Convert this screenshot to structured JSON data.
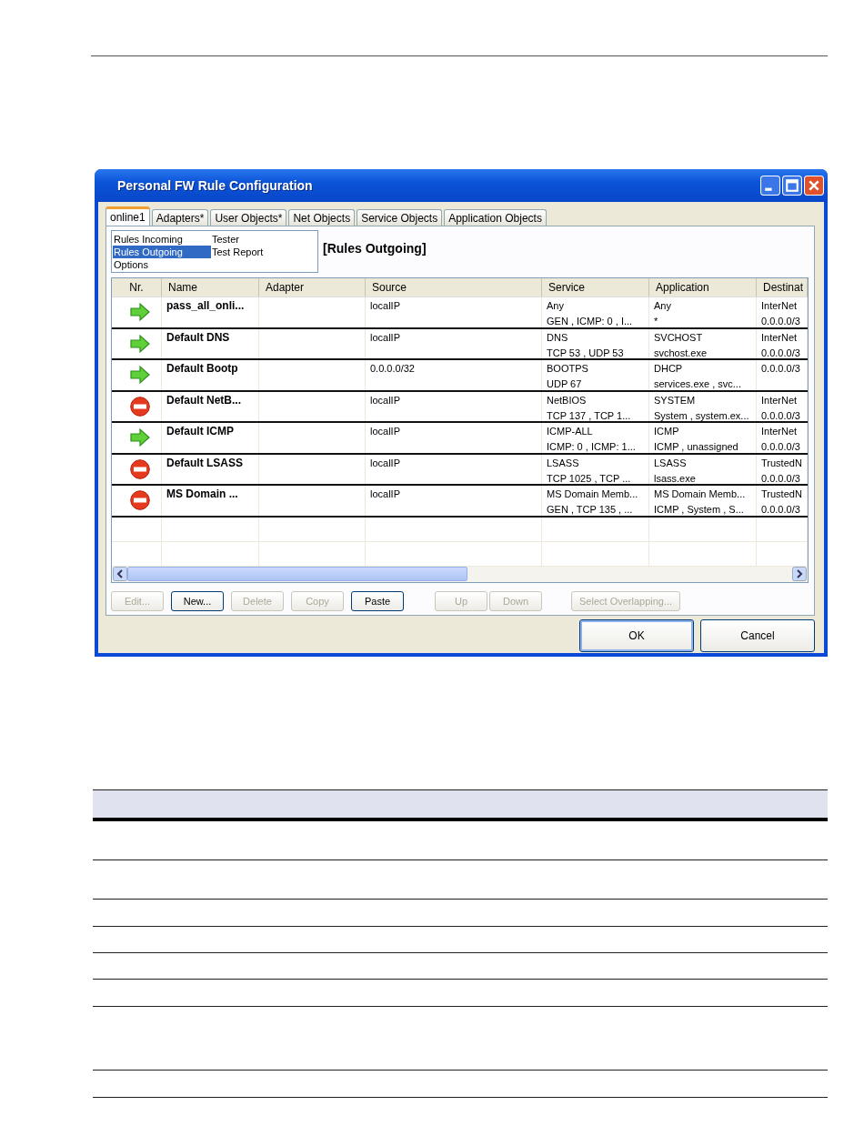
{
  "window": {
    "title": "Personal FW Rule Configuration"
  },
  "tabs": [
    {
      "label": "online1",
      "selected": true
    },
    {
      "label": "Adapters*",
      "selected": false
    },
    {
      "label": "User Objects*",
      "selected": false
    },
    {
      "label": "Net Objects",
      "selected": false
    },
    {
      "label": "Service Objects",
      "selected": false
    },
    {
      "label": "Application Objects",
      "selected": false
    }
  ],
  "nav_list": [
    {
      "label": "Rules Incoming",
      "selected": false
    },
    {
      "label": "Rules Outgoing",
      "selected": true
    },
    {
      "label": "Options",
      "selected": false
    },
    {
      "label": "Tester",
      "selected": false
    },
    {
      "label": "Test Report",
      "selected": false
    }
  ],
  "section_title": "[Rules Outgoing]",
  "table": {
    "columns": [
      "Nr.",
      "Name",
      "Adapter",
      "Source",
      "Service",
      "Application",
      "Destinat"
    ],
    "rows": [
      {
        "kind": "allow",
        "name": "pass_all_onli...",
        "source": "localIP",
        "service": [
          "Any",
          "GEN  , ICMP: 0 , I..."
        ],
        "application": [
          "Any",
          "*"
        ],
        "destination": [
          "InterNet",
          "0.0.0.0/3"
        ]
      },
      {
        "kind": "allow",
        "name": "Default DNS",
        "source": "localIP",
        "service": [
          "DNS",
          "TCP  53 , UDP  53"
        ],
        "application": [
          "SVCHOST",
          "svchost.exe"
        ],
        "destination": [
          "InterNet",
          "0.0.0.0/3"
        ]
      },
      {
        "kind": "allow",
        "name": "Default Bootp",
        "source": "0.0.0.0/32",
        "service": [
          "BOOTPS",
          "UDP  67"
        ],
        "application": [
          "DHCP",
          "services.exe , svc..."
        ],
        "destination": [
          "0.0.0.0/3"
        ]
      },
      {
        "kind": "deny",
        "name": "Default NetB...",
        "source": "localIP",
        "service": [
          "NetBIOS",
          "TCP  137 , TCP  1..."
        ],
        "application": [
          "SYSTEM",
          "System , system.ex..."
        ],
        "destination": [
          "InterNet",
          "0.0.0.0/3"
        ]
      },
      {
        "kind": "allow",
        "name": "Default ICMP",
        "source": "localIP",
        "service": [
          "ICMP-ALL",
          "ICMP: 0 , ICMP: 1..."
        ],
        "application": [
          "ICMP",
          "ICMP , unassigned"
        ],
        "destination": [
          "InterNet",
          "0.0.0.0/3"
        ]
      },
      {
        "kind": "deny",
        "name": "Default LSASS",
        "source": "localIP",
        "service": [
          "LSASS",
          "TCP  1025 , TCP  ..."
        ],
        "application": [
          "LSASS",
          "lsass.exe"
        ],
        "destination": [
          "TrustedN",
          "0.0.0.0/3"
        ]
      },
      {
        "kind": "deny",
        "name": "MS Domain ...",
        "source": "localIP",
        "service": [
          "MS Domain Memb...",
          "GEN  , TCP  135 , ..."
        ],
        "application": [
          "MS Domain Memb...",
          "ICMP , System , S..."
        ],
        "destination": [
          "TrustedN",
          "0.0.0.0/3"
        ]
      }
    ]
  },
  "actions": [
    {
      "label": "Edit...",
      "disabled": true
    },
    {
      "label": "New...",
      "disabled": false
    },
    {
      "label": "Delete",
      "disabled": true
    },
    {
      "label": "Copy",
      "disabled": true
    },
    {
      "label": "Paste",
      "disabled": false
    },
    {
      "label": "Up",
      "disabled": true
    },
    {
      "label": "Down",
      "disabled": true
    },
    {
      "label": "Select Overlapping...",
      "disabled": true
    }
  ],
  "dialog_buttons": [
    "OK",
    "Cancel"
  ]
}
